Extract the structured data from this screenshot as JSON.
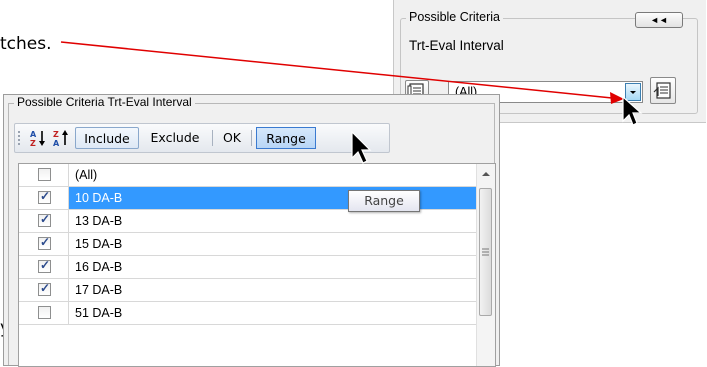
{
  "document": {
    "fragment_top": "tches.",
    "fragment_bottom": "y"
  },
  "criteria_panel": {
    "legend": "Possible Criteria",
    "collapse_label": "◄◄",
    "subtitle": "Trt-Eval Interval",
    "combo_value": "(All)",
    "left_icon": "list-view-icon",
    "right_icon": "criteria-editor-icon"
  },
  "popup": {
    "title": "Possible Criteria Trt-Eval Interval",
    "toolbar": {
      "sort_asc_icon": "sort-ascending-icon",
      "sort_desc_icon": "sort-descending-icon",
      "include_label": "Include",
      "exclude_label": "Exclude",
      "ok_label": "OK",
      "range_label": "Range"
    },
    "items": [
      {
        "label": "(All)",
        "checked": false,
        "selected": false
      },
      {
        "label": "10 DA-B",
        "checked": true,
        "selected": true
      },
      {
        "label": "13 DA-B",
        "checked": true,
        "selected": false
      },
      {
        "label": "15 DA-B",
        "checked": true,
        "selected": false
      },
      {
        "label": "16 DA-B",
        "checked": true,
        "selected": false
      },
      {
        "label": "17 DA-B",
        "checked": true,
        "selected": false
      },
      {
        "label": "51 DA-B",
        "checked": false,
        "selected": false
      }
    ],
    "tooltip": "Range"
  },
  "colors": {
    "arrow": "#e00000",
    "selection": "#3399ff"
  }
}
